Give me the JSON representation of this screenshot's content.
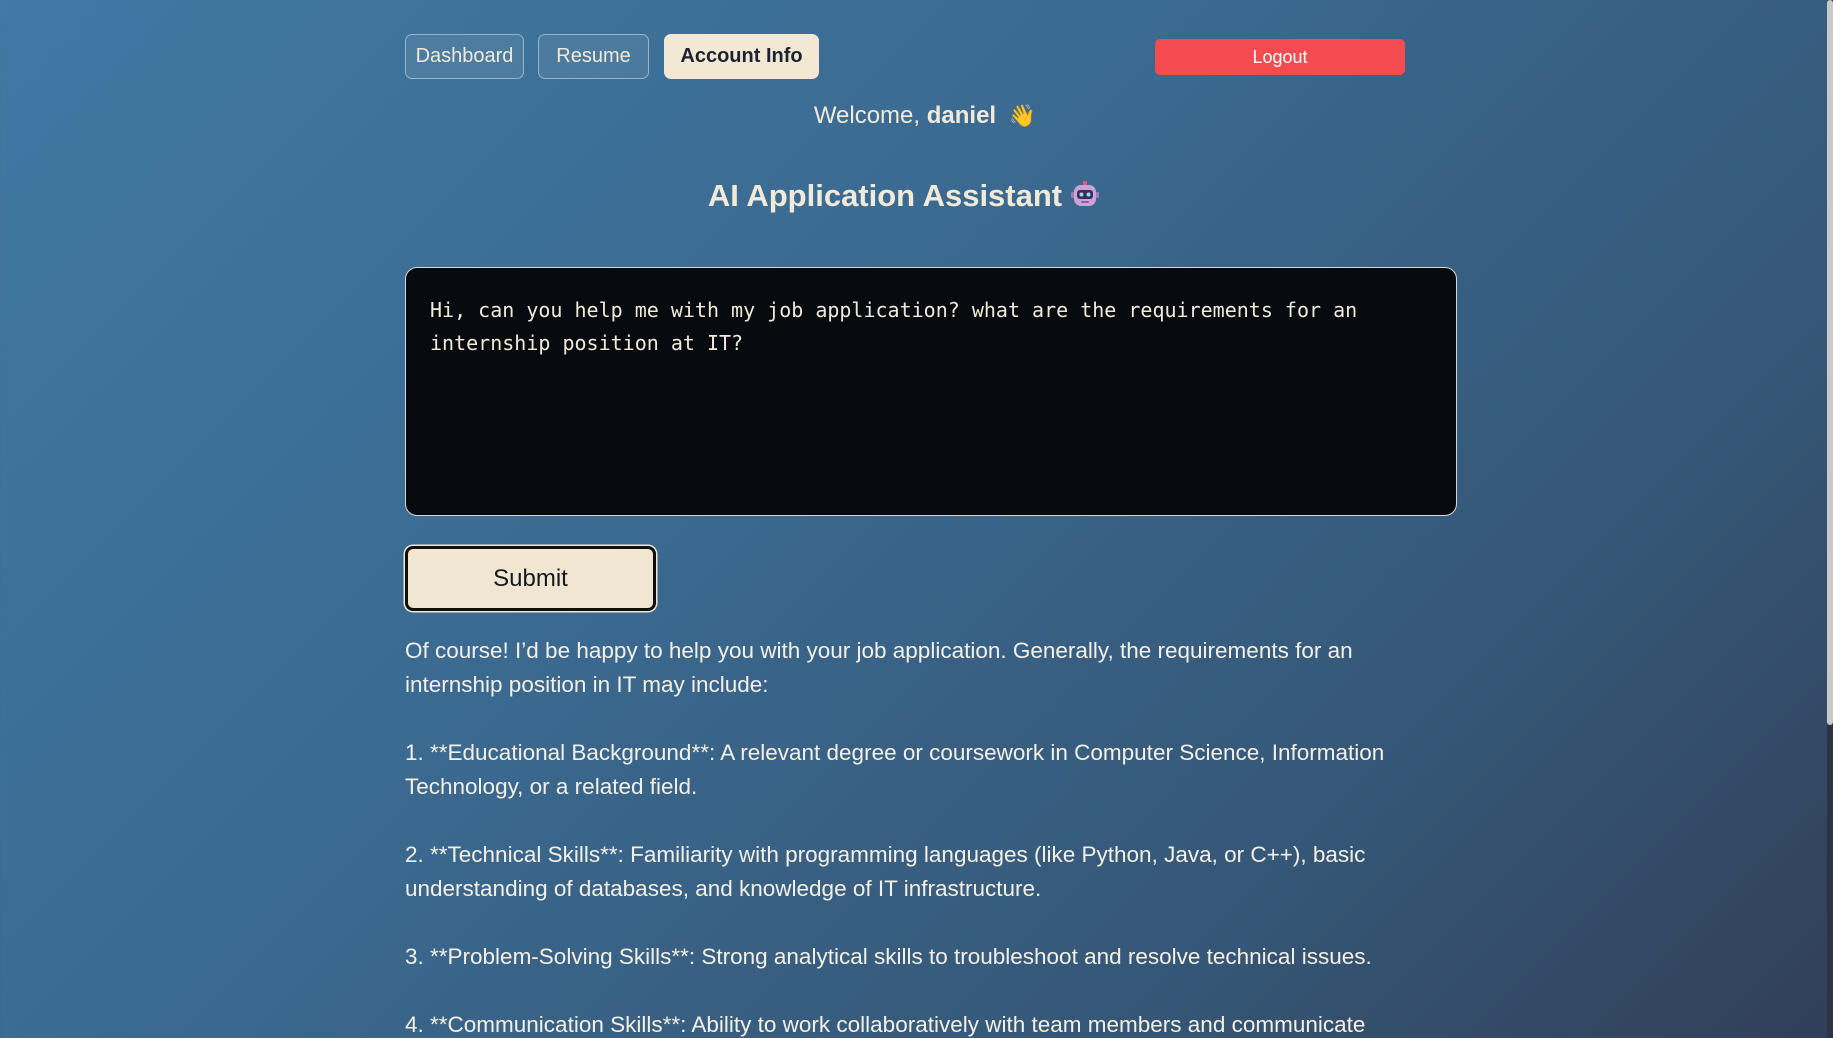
{
  "nav": {
    "tabs": [
      {
        "label": "Dashboard"
      },
      {
        "label": "Resume"
      },
      {
        "label": "Account Info"
      }
    ],
    "logout_label": "Logout"
  },
  "welcome": {
    "prefix": "Welcome, ",
    "username": "daniel",
    "emoji": "👋"
  },
  "title": "AI Application Assistant",
  "prompt": {
    "value": "Hi, can you help me with my job application? what are the requirements for an internship position at IT?"
  },
  "submit_label": "Submit",
  "response": {
    "paragraphs": [
      "Of course! I’d be happy to help you with your job application. Generally, the requirements for an internship position in IT may include:",
      "1. **Educational Background**: A relevant degree or coursework in Computer Science, Information Technology, or a related field.",
      "2. **Technical Skills**: Familiarity with programming languages (like Python, Java, or C++), basic understanding of databases, and knowledge of IT infrastructure.",
      "3. **Problem-Solving Skills**: Strong analytical skills to troubleshoot and resolve technical issues.",
      "4. **Communication Skills**: Ability to work collaboratively with team members and communicate"
    ]
  },
  "colors": {
    "logout": "#f34b4f",
    "active_tab": "#f2e8d4",
    "prompt_bg": "#070b0f",
    "text": "#f2ead8"
  },
  "icons": [
    "waving-hand-icon",
    "robot-icon"
  ]
}
